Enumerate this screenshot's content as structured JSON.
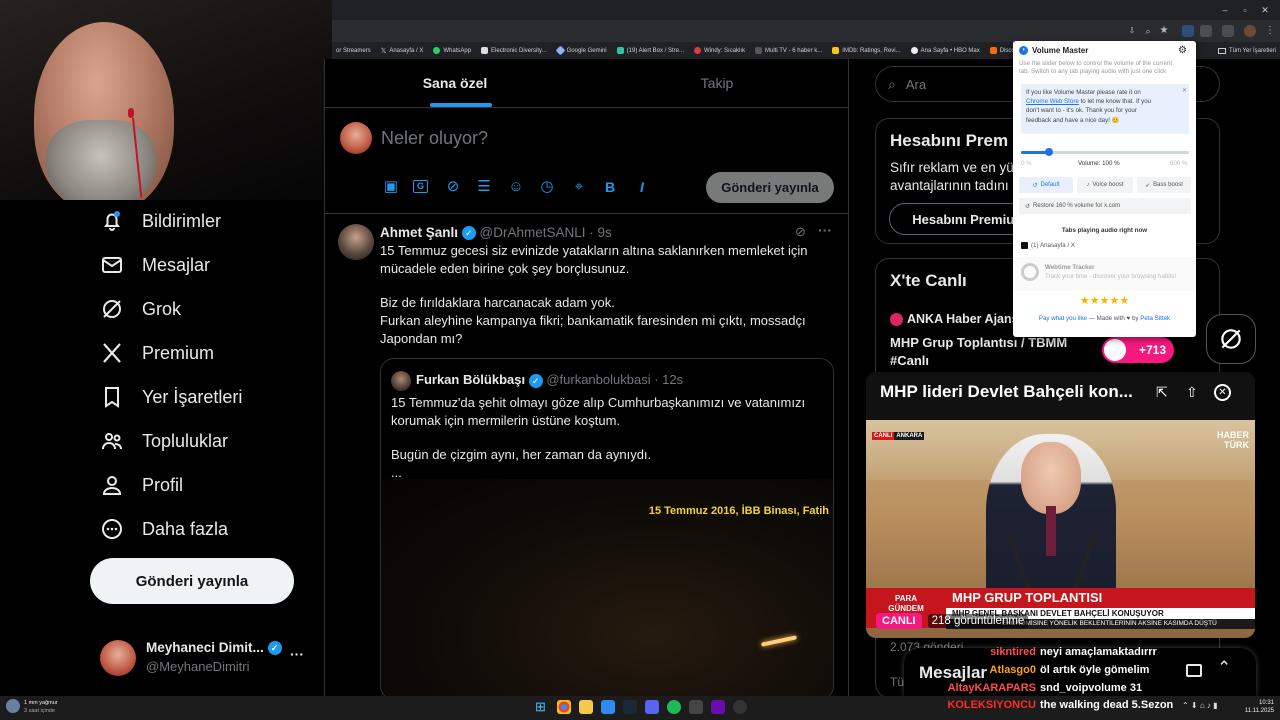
{
  "browser": {
    "bookmarks": [
      "or Streamers",
      "Anasayfa / X",
      "WhatsApp",
      "Electronic Diversity...",
      "Google Gemini",
      "(19) Alert Box / Stre...",
      "Windy: Sıcaklık",
      "Multi TV - 6 haber k...",
      "IMDb: Ratings, Revi...",
      "Ana Sayfa • HBO Max",
      "Discover -"
    ],
    "all_bookmarks": "Tüm Yer İşaretleri"
  },
  "nav": {
    "items": [
      "Bildirimler",
      "Mesajlar",
      "Grok",
      "Premium",
      "Yer İşaretleri",
      "Topluluklar",
      "Profil",
      "Daha fazla"
    ],
    "post_button": "Gönderi yayınla",
    "profile_name": "Meyhaneci Dimit...",
    "profile_handle": "@MeyhaneDimitri",
    "more": "···"
  },
  "feed": {
    "tabs": [
      "Sana özel",
      "Takip"
    ],
    "compose_placeholder": "Neler oluyor?",
    "send_button": "Gönderi yayınla",
    "tweet": {
      "name": "Ahmet Şanlı",
      "handle": "@DrAhmetSANLI",
      "time": "· 9s",
      "lines": [
        "15 Temmuz gecesi siz evinizde yatakların altına saklanırken memleket için",
        "mücadele eden birine çok şey borçlusunuz.",
        "",
        "Biz de fırıldaklara harcanacak adam yok.",
        "Furkan aleyhine kampanya fikri; bankamatik faresinden mi çıktı, mossadçı",
        "Japondan mı?"
      ]
    },
    "quote": {
      "name": "Furkan Bölükbaşı",
      "handle": "@furkanbolukbasi",
      "time": "· 12s",
      "lines": [
        "15 Temmuz'da şehit olmayı göze alıp Cumhurbaşkanımızı ve vatanımızı",
        "korumak için mermilerin üstüne koştum.",
        "",
        "Bugün de çizgim aynı, her zaman da aynıydı.",
        "..."
      ],
      "video_caption": "15 Temmuz 2016, İBB Binası, Fatih"
    }
  },
  "right": {
    "search_placeholder": "Ara",
    "premium_title": "Hesabını Prem",
    "premium_text_1": "Sıfır reklam ve en yük",
    "premium_text_2": "avantajlarının tadını ç",
    "premium_button": "Hesabını Premium",
    "live_title": "X'te Canlı",
    "live_source": "ANKA Haber Ajans",
    "live_topic_1": "MHP Grup Toplantısı / TBMM",
    "live_topic_2": "#Canlı",
    "live_count": "+713",
    "partial_count": "2.073 gönderi",
    "partial_text": "Tür"
  },
  "volume_master": {
    "title": "Volume Master",
    "desc_1": "Use the slider below to control the volume of the current",
    "desc_2": "tab. Switch to any tab playing audio with just one click",
    "notice_1": "If you like Volume Master please rate it on",
    "notice_link": "Chrome Web Store",
    "notice_2": " to let me know that. If you",
    "notice_3": "don't want to - it's ok. Thank you for your",
    "notice_4": "feedback and have a nice day! 😊",
    "min_label": "0 %",
    "volume_label": "Volume: 100 %",
    "max_label": "600 %",
    "volume_fraction": 0.1667,
    "btn_default": "Default",
    "btn_voice": "Voice boost",
    "btn_bass": "Bass boost",
    "restore": "Restore 160 % volume for x.com",
    "tabs_heading": "Tabs playing audio right now",
    "tab_item": "(1) Anasayfa / X",
    "tracker_title": "Webtime Tracker",
    "tracker_desc": "Track your time - discover your browsing habits!",
    "pay_text": "Pay what you like",
    "made_with": " — Made with ♥ by ",
    "author": "Peta Sittek"
  },
  "pip": {
    "title": "MHP lideri Devlet Bahçeli kon...",
    "canli_badge": "CANLI",
    "channel_tag": "ANKARA",
    "logo_1": "HABER",
    "logo_2": "TÜRK",
    "para": "PARA",
    "gundem": "GÜNDEM",
    "headline": "MHP GRUP TOPLANTISI",
    "subhead": "MHP GENEL BAŞKANI DEVLET BAHÇELİ KONUŞUYOR",
    "ticker": "EKONOMİSİNE YÖNELİK BEKLENTİLERİNİN AKSİNE KASIMDA DÜŞTÜ",
    "live_label": "CANLI",
    "views": "218 görüntülenme"
  },
  "chat": {
    "messages_label": "Mesajlar",
    "lines": [
      {
        "user": "sikntired",
        "text": "neyi amaçlamaktadırrr",
        "color": "#ff4d4d"
      },
      {
        "user": "Atlasgo0",
        "text": "öl artık öyle gömelim",
        "color": "#ff9f1a"
      },
      {
        "user": "AltayKARAPARS",
        "text": "snd_voipvolume 31",
        "color": "#ff4d4d"
      },
      {
        "user": "KOLEKSIYONCU",
        "text": "the walking dead 5.Sezon",
        "color": "#ff2a2a"
      }
    ]
  },
  "taskbar": {
    "weather_1": "1 mm yağmur",
    "weather_2": "3 saat içinde",
    "time": "10:31",
    "date": "11.11.2025"
  }
}
